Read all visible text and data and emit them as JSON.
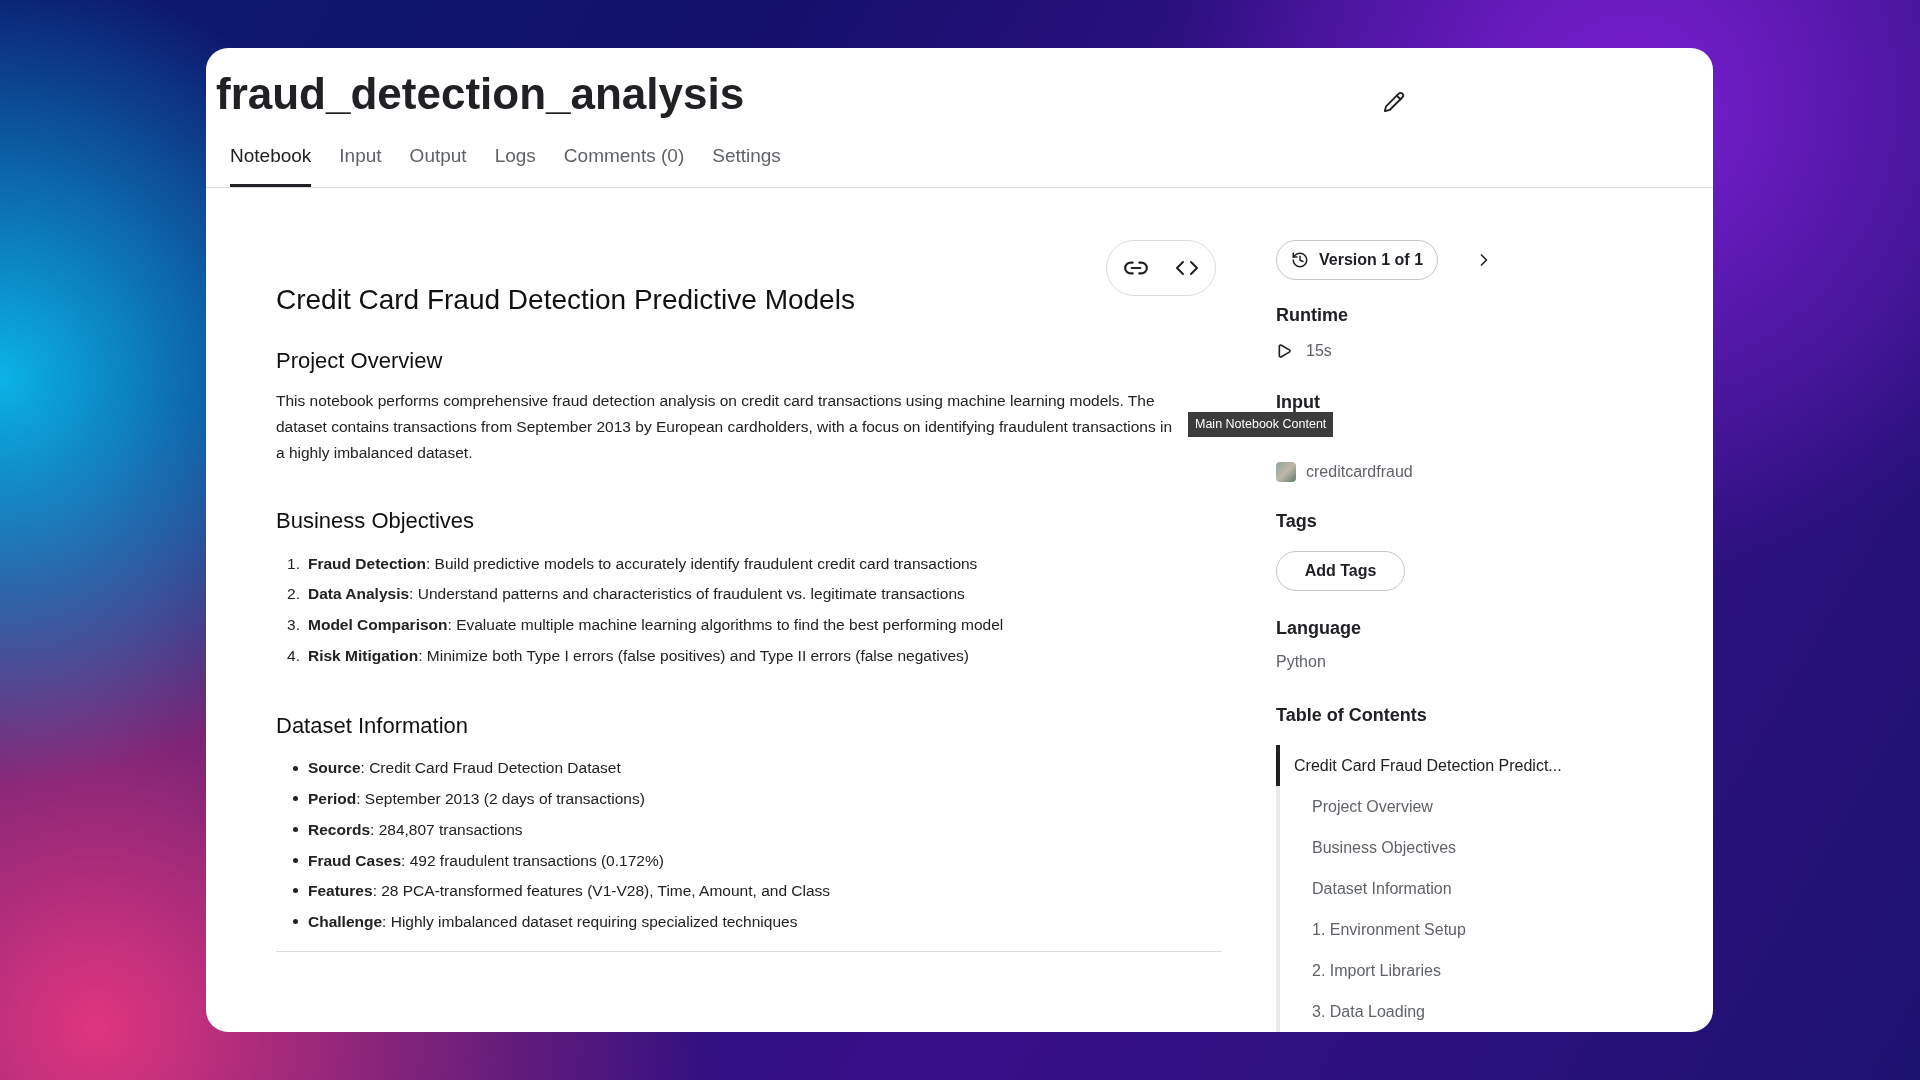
{
  "notebook": {
    "title": "fraud_detection_analysis"
  },
  "tabs": [
    {
      "label": "Notebook",
      "selected": true
    },
    {
      "label": "Input",
      "selected": false
    },
    {
      "label": "Output",
      "selected": false
    },
    {
      "label": "Logs",
      "selected": false
    },
    {
      "label": "Comments (0)",
      "selected": false
    },
    {
      "label": "Settings",
      "selected": false
    }
  ],
  "content": {
    "heading": "Credit Card Fraud Detection Predictive Models",
    "tooltip": "Main Notebook Content",
    "sections": [
      {
        "kind": "paragraph",
        "heading": "Project Overview",
        "text": "This notebook performs comprehensive fraud detection analysis on credit card transactions using machine learning models. The dataset contains transactions from September 2013 by European cardholders, with a focus on identifying fraudulent transactions in a highly imbalanced dataset."
      },
      {
        "kind": "numbered",
        "heading": "Business Objectives",
        "items": [
          {
            "number": "1.",
            "text": "**Fraud Detection**: Build predictive models to accurately identify fraudulent credit card transactions"
          },
          {
            "number": "2.",
            "text": "**Data Analysis**: Understand patterns and characteristics of fraudulent vs. legitimate transactions"
          },
          {
            "number": "3.",
            "text": "**Model Comparison**: Evaluate multiple machine learning algorithms to find the best performing model"
          },
          {
            "number": "4.",
            "text": "**Risk Mitigation**: Minimize both Type I errors (false positives) and Type II errors (false negatives)"
          }
        ]
      },
      {
        "kind": "bulleted",
        "heading": "Dataset Information",
        "items": [
          {
            "text": "**Source**: Credit Card Fraud Detection Dataset"
          },
          {
            "text": "**Period**: September 2013 (2 days of transactions)"
          },
          {
            "text": "**Records**: 284,807 transactions"
          },
          {
            "text": "**Fraud Cases**: 492 fraudulent transactions (0.172%)"
          },
          {
            "text": "**Features**: 28 PCA-transformed features (V1-V28), Time, Amount, and Class"
          },
          {
            "text": "**Challenge**: Highly imbalanced dataset requiring specialized techniques"
          }
        ]
      }
    ]
  },
  "sidebar": {
    "version": "Version 1 of 1",
    "runtime": {
      "label": "Runtime",
      "value": "15s"
    },
    "input": {
      "label": "Input",
      "dataset": "creditcardfraud"
    },
    "tags": {
      "label": "Tags",
      "button": "Add Tags"
    },
    "language": {
      "label": "Language",
      "value": "Python"
    },
    "toc": {
      "label": "Table of Contents",
      "items": [
        {
          "text": "Credit Card Fraud Detection Predict...",
          "selected": true,
          "children": [
            {
              "text": "Project Overview",
              "selected": false
            },
            {
              "text": "Business Objectives",
              "selected": false
            },
            {
              "text": "Dataset Information",
              "selected": false
            },
            {
              "text": "1. Environment Setup",
              "selected": false
            },
            {
              "text": "2. Import Libraries",
              "selected": false
            },
            {
              "text": "3. Data Loading",
              "selected": false
            }
          ]
        }
      ]
    }
  }
}
